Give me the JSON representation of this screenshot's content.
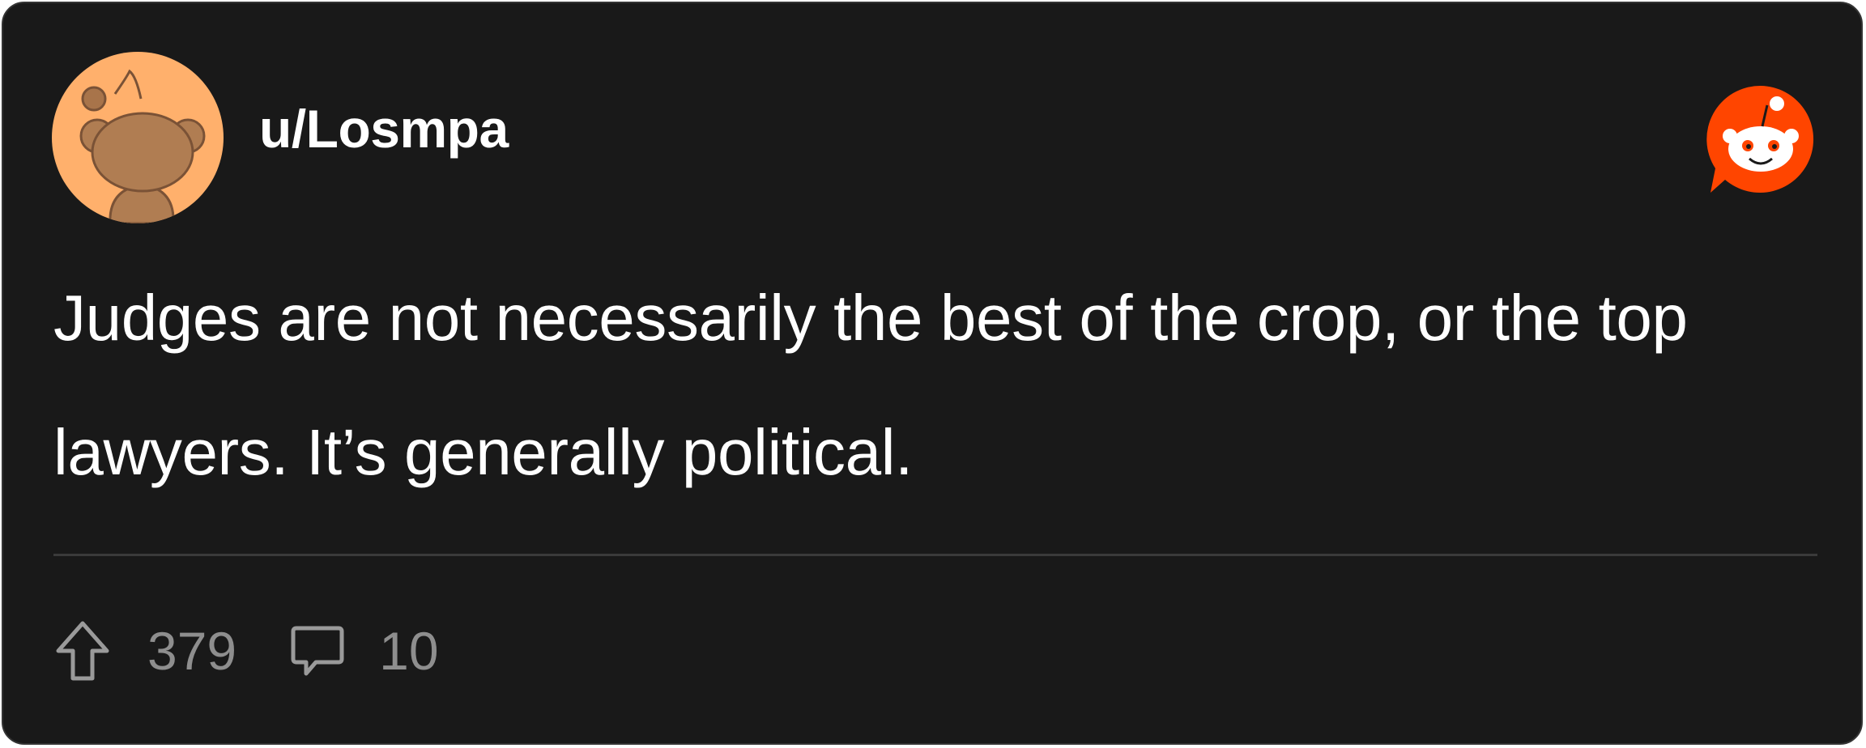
{
  "post": {
    "username": "u/Losmpa",
    "body": "Judges are not necessarily the best of the crop, or the top lawyers. It’s generally political.",
    "upvotes": "379",
    "comments": "10"
  },
  "icons": {
    "avatar": "snoo-avatar",
    "brand": "reddit-logo-icon",
    "upvote": "upvote-arrow-icon",
    "comment": "comment-bubble-icon"
  },
  "colors": {
    "card_background": "#191919",
    "avatar_background": "#ffb06c",
    "brand": "#ff4500",
    "muted_text": "#8e8e8e"
  }
}
